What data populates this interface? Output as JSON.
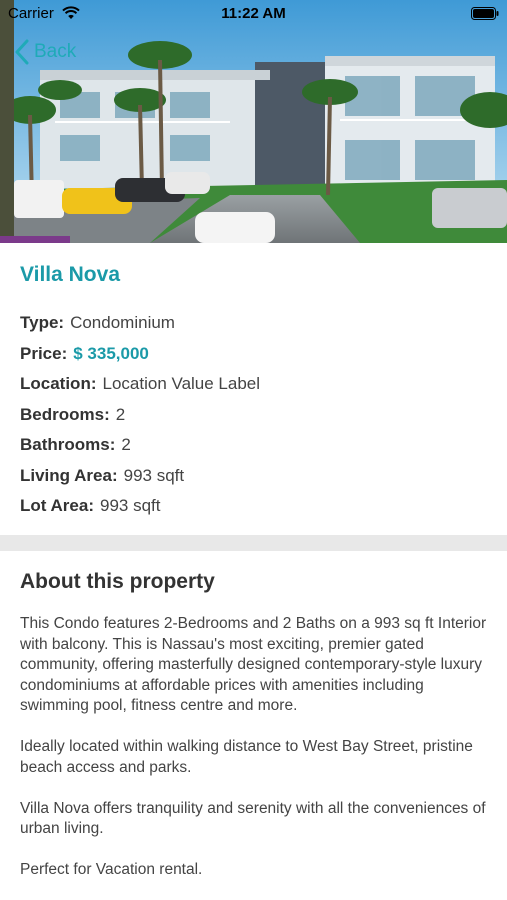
{
  "status_bar": {
    "carrier": "Carrier",
    "time": "11:22 AM"
  },
  "nav": {
    "back_label": "Back"
  },
  "property": {
    "title": "Villa Nova",
    "details": [
      {
        "key": "Type:",
        "value": "Condominium"
      },
      {
        "key": "Price:",
        "value": "$ 335,000"
      },
      {
        "key": "Location:",
        "value": "Location Value Label"
      },
      {
        "key": "Bedrooms:",
        "value": "2"
      },
      {
        "key": "Bathrooms:",
        "value": "2"
      },
      {
        "key": "Living Area:",
        "value": "993 sqft"
      },
      {
        "key": "Lot Area:",
        "value": "993 sqft"
      }
    ]
  },
  "about": {
    "title": "About this property",
    "paragraphs": [
      "This Condo features 2-Bedrooms and 2 Baths on a 993 sq ft Interior with  balcony.  This is Nassau's most exciting, premier gated community, offering masterfully designed contemporary-style luxury condominiums at affordable prices with amenities including swimming pool, fitness centre and more.",
      "Ideally located within walking distance to West Bay Street, pristine beach access and parks.",
      "Villa Nova offers tranquility and serenity with all the conveniences of urban living.",
      "Perfect for Vacation rental."
    ]
  },
  "colors": {
    "accent": "#1b9aa8",
    "divider": "#e8e8e8"
  }
}
